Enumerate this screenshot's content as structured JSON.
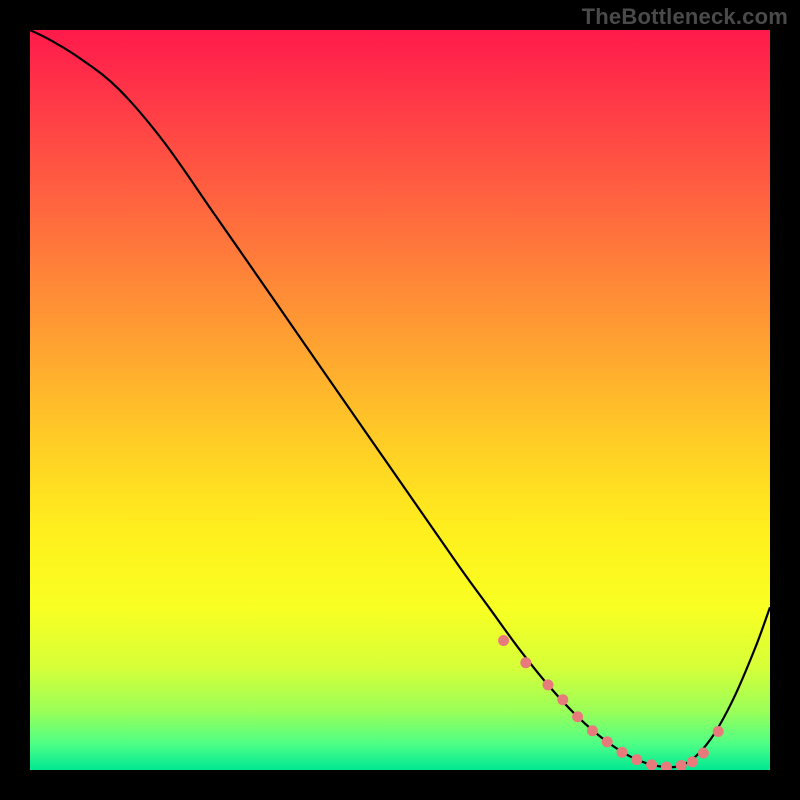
{
  "watermark": "TheBottleneck.com",
  "colors": {
    "frame": "#000000",
    "watermark_text": "#4a4a4a",
    "curve_stroke": "#000000",
    "marker_fill": "#e77b7b",
    "marker_stroke": "#e77b7b",
    "gradient_stops": [
      {
        "offset": 0.0,
        "color": "#ff1a4b"
      },
      {
        "offset": 0.1,
        "color": "#ff3a47"
      },
      {
        "offset": 0.25,
        "color": "#ff6a3e"
      },
      {
        "offset": 0.4,
        "color": "#ff9a33"
      },
      {
        "offset": 0.55,
        "color": "#ffcb26"
      },
      {
        "offset": 0.68,
        "color": "#fff01d"
      },
      {
        "offset": 0.78,
        "color": "#f9ff22"
      },
      {
        "offset": 0.86,
        "color": "#d7ff38"
      },
      {
        "offset": 0.92,
        "color": "#9bff58"
      },
      {
        "offset": 0.965,
        "color": "#4dff86"
      },
      {
        "offset": 1.0,
        "color": "#00e793"
      }
    ]
  },
  "chart_data": {
    "type": "line",
    "title": "",
    "xlabel": "",
    "ylabel": "",
    "xlim": [
      0,
      100
    ],
    "ylim": [
      0,
      100
    ],
    "grid": false,
    "legend": false,
    "annotations": [],
    "series": [
      {
        "name": "bottleneck-curve",
        "x": [
          0,
          3,
          7,
          12,
          18,
          25,
          33,
          42,
          50,
          58,
          62,
          66,
          70,
          74,
          78,
          82,
          86,
          89,
          92,
          95,
          98,
          100
        ],
        "y": [
          100,
          98.5,
          96,
          92,
          85,
          75,
          63.5,
          50.5,
          39,
          27.5,
          22,
          16.5,
          11.5,
          7.2,
          3.8,
          1.4,
          0.4,
          1.1,
          4.2,
          9.5,
          16.5,
          22
        ]
      }
    ],
    "markers": {
      "name": "highlight-range",
      "x": [
        64,
        67,
        70,
        72,
        74,
        76,
        78,
        80,
        82,
        84,
        86,
        88,
        89.5,
        91,
        93
      ],
      "y": [
        17.5,
        14.5,
        11.5,
        9.5,
        7.2,
        5.3,
        3.8,
        2.4,
        1.4,
        0.7,
        0.4,
        0.6,
        1.1,
        2.3,
        5.2
      ]
    }
  }
}
